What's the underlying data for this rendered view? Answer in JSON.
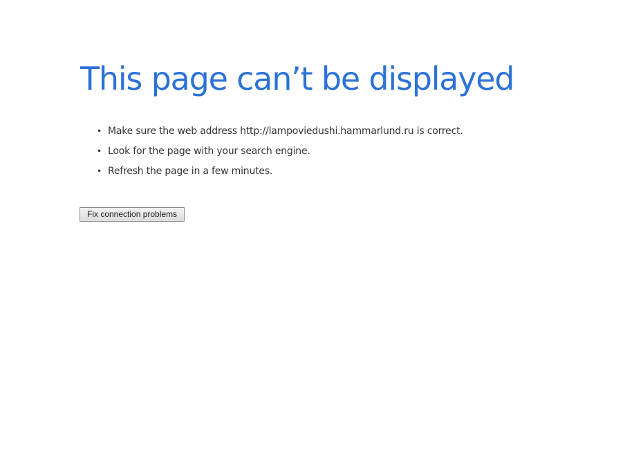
{
  "error_page": {
    "title": "This page can’t be displayed",
    "suggestions": [
      "Make sure the web address http://lampoviedushi.hammarlund.ru is correct.",
      "Look for the page with your search engine.",
      "Refresh the page in a few minutes."
    ],
    "bullet_glyph": "•",
    "fix_button_label": "Fix connection problems"
  },
  "colors": {
    "title": "#2c72d6",
    "body_text": "#333333",
    "background": "#ffffff"
  }
}
